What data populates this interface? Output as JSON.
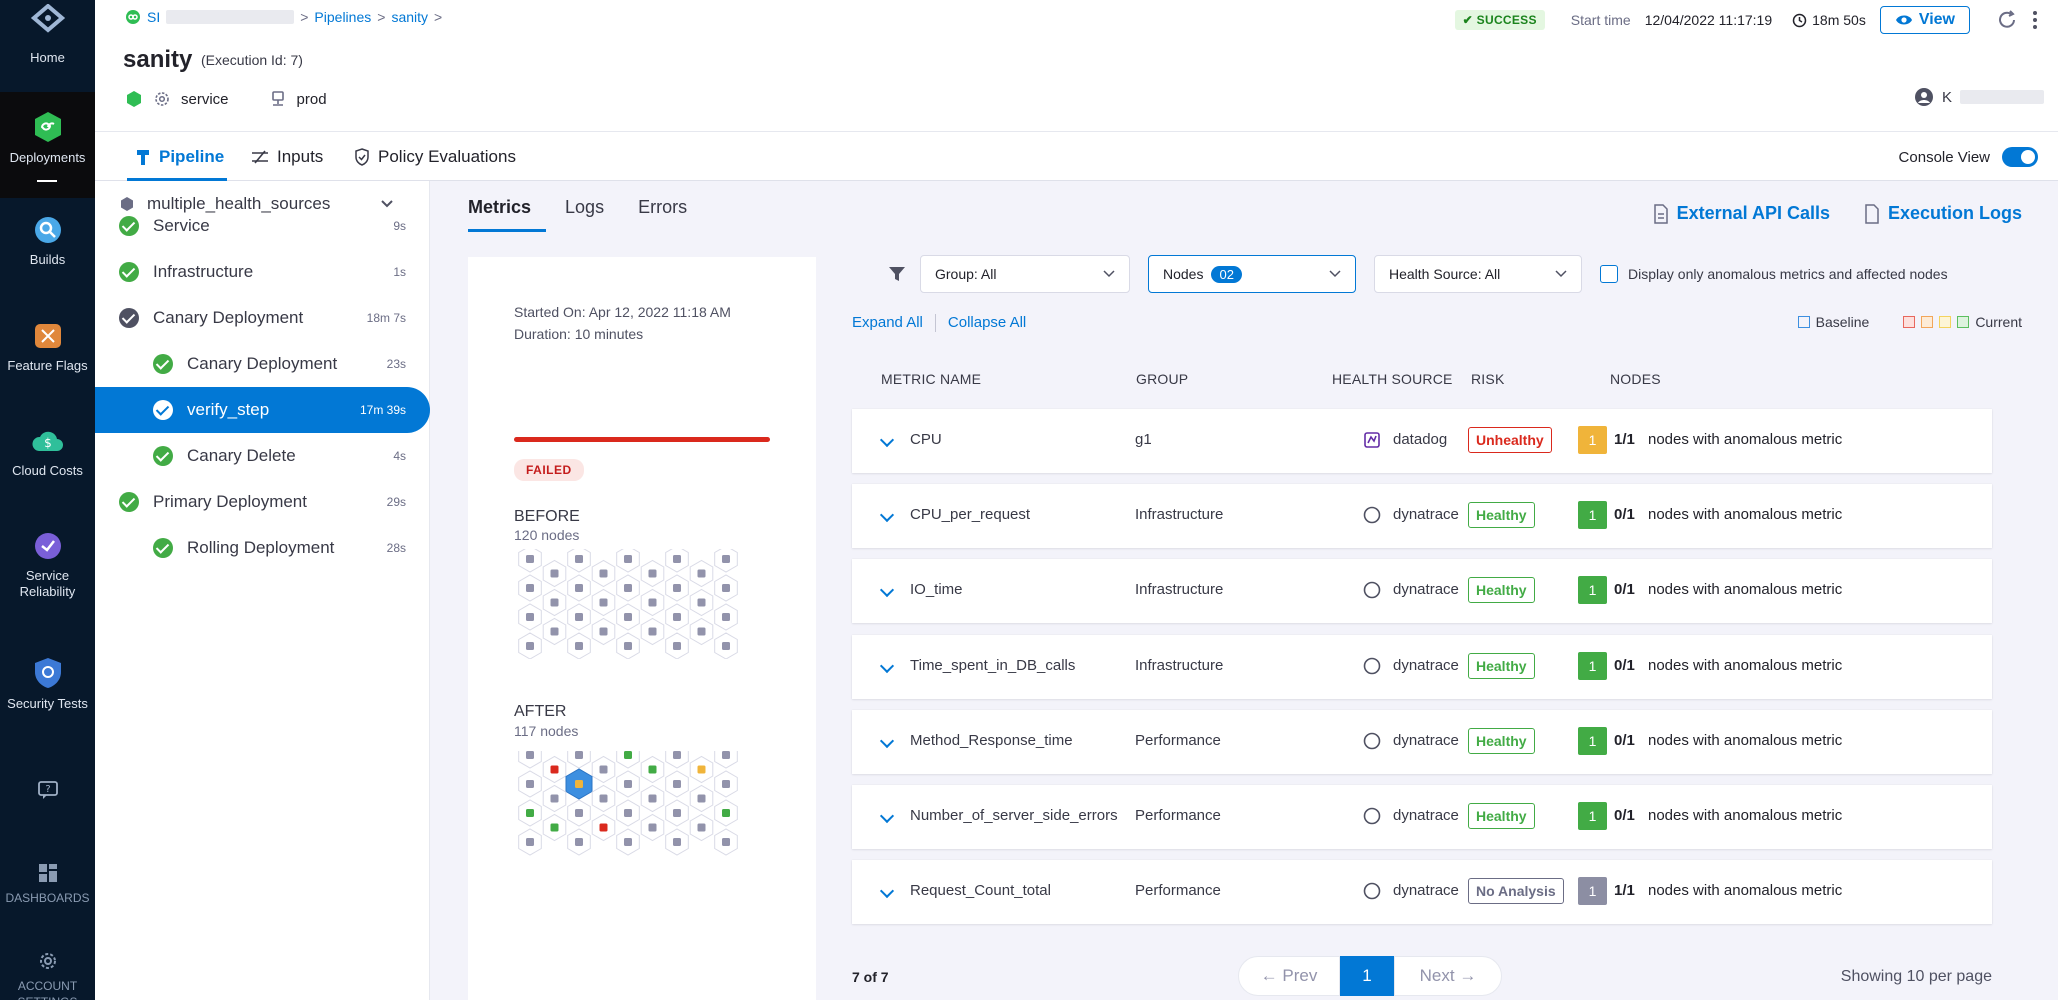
{
  "nav": {
    "home": "Home",
    "deployments": "Deployments",
    "builds": "Builds",
    "feature_flags": "Feature Flags",
    "cloud_costs": "Cloud Costs",
    "service_reliability": "Service Reliability",
    "security_tests": "Security Tests",
    "dashboards": "DASHBOARDS",
    "account_settings": "ACCOUNT SETTINGS"
  },
  "header": {
    "breadcrumb_project": "SI",
    "breadcrumb_pipelines": "Pipelines",
    "breadcrumb_pipeline": "sanity",
    "title": "sanity",
    "execution_id": "(Execution Id: 7)",
    "service": "service",
    "environment": "prod",
    "status": "SUCCESS",
    "start_time_label": "Start time",
    "start_time_value": "12/04/2022 11:17:19",
    "duration": "18m 50s",
    "view_label": "View",
    "user_initial": "K"
  },
  "tabs": {
    "pipeline": "Pipeline",
    "inputs": "Inputs",
    "policy_evaluations": "Policy Evaluations",
    "console_view": "Console View"
  },
  "tree": {
    "root": "multiple_health_sources",
    "items": [
      {
        "label": "Service",
        "duration": "9s"
      },
      {
        "label": "Infrastructure",
        "duration": "1s"
      },
      {
        "label": "Canary Deployment",
        "duration": "18m 7s"
      },
      {
        "label": "Canary Deployment",
        "duration": "23s"
      },
      {
        "label": "verify_step",
        "duration": "17m 39s"
      },
      {
        "label": "Canary Delete",
        "duration": "4s"
      },
      {
        "label": "Primary Deployment",
        "duration": "29s"
      },
      {
        "label": "Rolling Deployment",
        "duration": "28s"
      }
    ]
  },
  "subtabs": {
    "metrics": "Metrics",
    "logs": "Logs",
    "errors": "Errors",
    "external_api_calls": "External API Calls",
    "execution_logs": "Execution Logs"
  },
  "summary": {
    "started_on": "Started On: Apr 12, 2022 11:18 AM",
    "duration": "Duration: 10 minutes",
    "status": "FAILED",
    "before_label": "BEFORE",
    "before_nodes": "120 nodes",
    "after_label": "AFTER",
    "after_nodes": "117 nodes"
  },
  "filters": {
    "group": "Group: All",
    "nodes_label": "Nodes",
    "nodes_count": "02",
    "health_source": "Health Source: All",
    "anomalous_only": "Display only anomalous metrics and affected nodes",
    "expand_all": "Expand All",
    "collapse_all": "Collapse All",
    "legend_baseline": "Baseline",
    "legend_current": "Current"
  },
  "table": {
    "headers": {
      "metric": "METRIC NAME",
      "group": "GROUP",
      "health_source": "HEALTH SOURCE",
      "risk": "RISK",
      "nodes": "NODES"
    },
    "rows": [
      {
        "metric": "CPU",
        "group": "g1",
        "source": "datadog",
        "risk": "Unhealthy",
        "count": "1",
        "frac": "1/1",
        "nodes_text": "nodes with anomalous metric"
      },
      {
        "metric": "CPU_per_request",
        "group": "Infrastructure",
        "source": "dynatrace",
        "risk": "Healthy",
        "count": "1",
        "frac": "0/1",
        "nodes_text": "nodes with anomalous metric"
      },
      {
        "metric": "IO_time",
        "group": "Infrastructure",
        "source": "dynatrace",
        "risk": "Healthy",
        "count": "1",
        "frac": "0/1",
        "nodes_text": "nodes with anomalous metric"
      },
      {
        "metric": "Time_spent_in_DB_calls",
        "group": "Infrastructure",
        "source": "dynatrace",
        "risk": "Healthy",
        "count": "1",
        "frac": "0/1",
        "nodes_text": "nodes with anomalous metric"
      },
      {
        "metric": "Method_Response_time",
        "group": "Performance",
        "source": "dynatrace",
        "risk": "Healthy",
        "count": "1",
        "frac": "0/1",
        "nodes_text": "nodes with anomalous metric"
      },
      {
        "metric": "Number_of_server_side_errors",
        "group": "Performance",
        "source": "dynatrace",
        "risk": "Healthy",
        "count": "1",
        "frac": "0/1",
        "nodes_text": "nodes with anomalous metric"
      },
      {
        "metric": "Request_Count_total",
        "group": "Performance",
        "source": "dynatrace",
        "risk": "No Analysis",
        "count": "1",
        "frac": "1/1",
        "nodes_text": "nodes with anomalous metric"
      }
    ]
  },
  "footer": {
    "count": "7 of 7",
    "prev": "Prev",
    "page": "1",
    "next": "Next",
    "per_page": "Showing 10 per page"
  }
}
